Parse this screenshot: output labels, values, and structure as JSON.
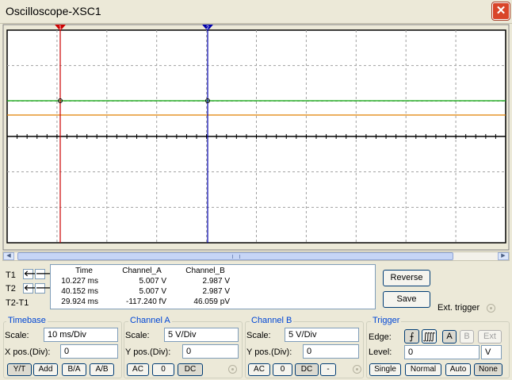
{
  "window": {
    "title": "Oscilloscope-XSC1",
    "close_glyph": "✕"
  },
  "scope": {
    "background": "#FFFFFF",
    "grid_color": "#A0A0A0",
    "cursor1_color": "#CC0000",
    "cursor2_color": "#0000AA",
    "channel_a_color": "#00A000",
    "channel_b_color": "#E08000",
    "cursor1_label": "1",
    "cursor2_label": "2"
  },
  "cursors": {
    "t1_label": "T1",
    "t2_label": "T2",
    "t2t1_label": "T2-T1",
    "left_arrow": "🡐",
    "right_arrow": "🡒"
  },
  "readout": {
    "headers": [
      "Time",
      "Channel_A",
      "Channel_B"
    ],
    "rows": [
      [
        "10.227 ms",
        "5.007 V",
        "2.987 V"
      ],
      [
        "40.152 ms",
        "5.007 V",
        "2.987 V"
      ],
      [
        "29.924 ms",
        "-117.240 fV",
        "46.059 pV"
      ]
    ]
  },
  "actions": {
    "reverse": "Reverse",
    "save": "Save",
    "ext_trigger": "Ext. trigger"
  },
  "timebase": {
    "title": "Timebase",
    "scale_label": "Scale:",
    "scale_value": "10 ms/Div",
    "xpos_label": "X pos.(Div):",
    "xpos_value": "0",
    "modes": [
      "Y/T",
      "Add",
      "B/A",
      "A/B"
    ]
  },
  "channel_a": {
    "title": "Channel A",
    "scale_label": "Scale:",
    "scale_value": "5  V/Div",
    "ypos_label": "Y pos.(Div):",
    "ypos_value": "0",
    "coupling": [
      "AC",
      "0",
      "DC"
    ]
  },
  "channel_b": {
    "title": "Channel B",
    "scale_label": "Scale:",
    "scale_value": "5  V/Div",
    "ypos_label": "Y pos.(Div):",
    "ypos_value": "0",
    "coupling": [
      "AC",
      "0",
      "DC",
      "-"
    ]
  },
  "trigger": {
    "title": "Trigger",
    "edge_label": "Edge:",
    "level_label": "Level:",
    "level_value": "0",
    "level_unit": "V",
    "edge_rise": "⨍",
    "edge_fall": "⨌",
    "sources": [
      "A",
      "B",
      "Ext"
    ],
    "modes": [
      "Single",
      "Normal",
      "Auto",
      "None"
    ]
  }
}
